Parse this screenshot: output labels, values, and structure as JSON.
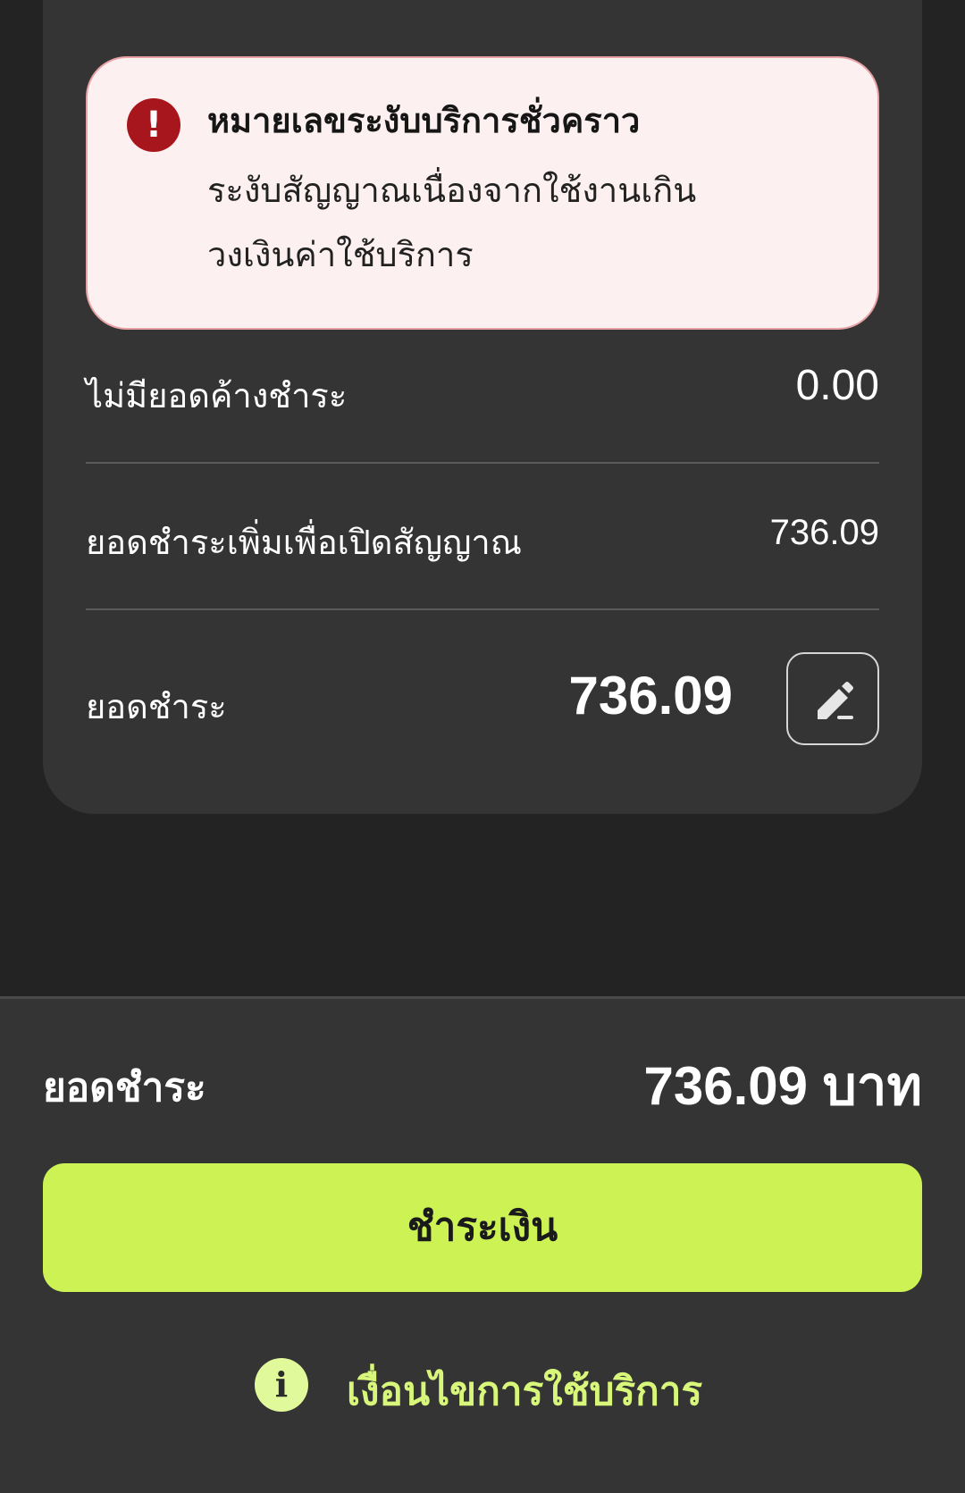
{
  "alert": {
    "icon": "exclamation-icon",
    "icon_glyph": "!",
    "title": "หมายเลขระงับบริการชั่วคราว",
    "message": "ระงับสัญญาณเนื่องจากใช้งานเกินวงเงินค่าใช้บริการ",
    "background_color": "#fdf0f0",
    "icon_color": "#a8161d"
  },
  "summary": {
    "outstanding_label": "ไม่มียอดค้างชำระ",
    "outstanding_value": "0.00",
    "reconnect_label": "ยอดชำระเพิ่มเพื่อเปิดสัญญาณ",
    "reconnect_value": "736.09",
    "payment_label": "ยอดชำระ",
    "payment_value": "736.09",
    "edit_icon": "pencil-icon"
  },
  "footer": {
    "total_label": "ยอดชำระ",
    "total_value": "736.09 บาท",
    "pay_button_label": "ชำระเงิน",
    "pay_button_color": "#cdf254",
    "terms_icon": "info-icon",
    "terms_icon_glyph": "i",
    "terms_label": "เงื่อนไขการใช้บริการ",
    "terms_color": "#d8f77a"
  }
}
